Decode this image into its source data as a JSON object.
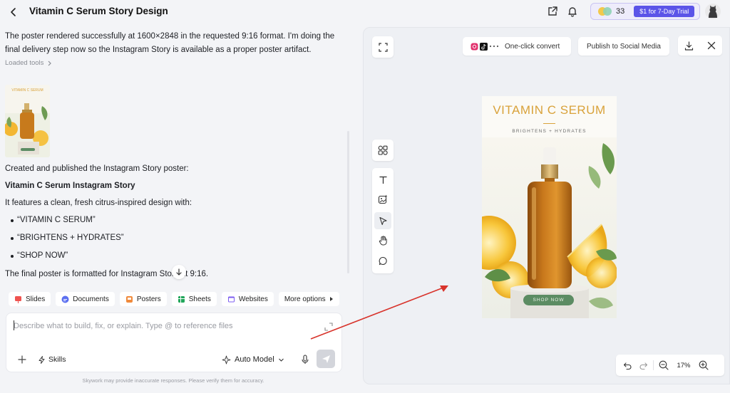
{
  "header": {
    "title": "Vitamin C Serum Story Design",
    "credits": "33",
    "trial_label": "$1 for 7-Day Trial"
  },
  "chat": {
    "intro": "The poster rendered successfully at 1600×2848 in the requested 9:16 format. I'm doing the final delivery step now so the Instagram Story is available as a proper poster artifact.",
    "loaded_tools": "Loaded tools",
    "thumbnail_title": "VITAMIN C SERUM",
    "created_line": "Created and published the Instagram Story poster:",
    "heading": "Vitamin C Serum Instagram Story",
    "features_line": "It features a clean, fresh citrus-inspired design with:",
    "bullets": [
      "“VITAMIN C SERUM”",
      "“BRIGHTENS + HYDRATES”",
      "“SHOP NOW”"
    ],
    "final_line": "The final poster is formatted for Instagram Story at 9:16.",
    "chips": [
      "Slides",
      "Documents",
      "Posters",
      "Sheets",
      "Websites",
      "More options"
    ],
    "composer": {
      "placeholder": "Describe what to build, fix, or explain. Type @ to reference files",
      "skills_label": "Skills",
      "model_label": "Auto Model"
    },
    "disclaimer": "Skywork may provide inaccurate responses. Please verify them for accuracy."
  },
  "preview": {
    "convert_label": "One-click convert",
    "publish_label": "Publish to Social Media",
    "zoom_level": "17%",
    "poster": {
      "title": "VITAMIN C SERUM",
      "subtitle": "BRIGHTENS + HYDRATES",
      "cta": "SHOP NOW"
    }
  },
  "colors": {
    "accent": "#5b54e8",
    "poster_gold": "#d9a23a",
    "poster_green": "#5c8c63",
    "annotation_arrow": "#d8332b"
  }
}
